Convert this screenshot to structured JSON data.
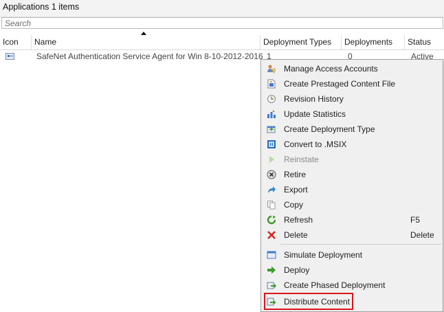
{
  "header": {
    "title": "Applications 1 items"
  },
  "search": {
    "placeholder": "Search"
  },
  "columns": [
    "Icon",
    "Name",
    "Deployment Types",
    "Deployments",
    "Status"
  ],
  "rows": [
    {
      "name": "SafeNet Authentication Service Agent for Win 8-10-2012-2016",
      "deployment_types": "1",
      "deployments": "0",
      "status": "Active"
    }
  ],
  "context_menu": {
    "items": [
      {
        "label": "Manage Access Accounts",
        "icon": "users-key-icon"
      },
      {
        "label": "Create Prestaged Content File",
        "icon": "prestaged-file-icon"
      },
      {
        "label": "Revision History",
        "icon": "history-icon"
      },
      {
        "label": "Update Statistics",
        "icon": "statistics-icon"
      },
      {
        "label": "Create Deployment Type",
        "icon": "create-deployment-type-icon"
      },
      {
        "label": "Convert to .MSIX",
        "icon": "msix-icon"
      },
      {
        "label": "Reinstate",
        "icon": "play-icon",
        "disabled": true
      },
      {
        "label": "Retire",
        "icon": "retire-x-circle-icon"
      },
      {
        "label": "Export",
        "icon": "export-arrow-icon"
      },
      {
        "label": "Copy",
        "icon": "copy-icon"
      },
      {
        "label": "Refresh",
        "icon": "refresh-icon",
        "shortcut": "F5"
      },
      {
        "label": "Delete",
        "icon": "delete-x-icon",
        "shortcut": "Delete"
      },
      {
        "label": "Simulate Deployment",
        "icon": "simulate-icon"
      },
      {
        "label": "Deploy",
        "icon": "deploy-arrow-icon"
      },
      {
        "label": "Create Phased Deployment",
        "icon": "phased-deployment-icon"
      },
      {
        "label": "Distribute Content",
        "icon": "distribute-content-icon"
      }
    ]
  },
  "colors": {
    "highlight": "#d9151b",
    "menu_background": "#f0f0f0"
  }
}
